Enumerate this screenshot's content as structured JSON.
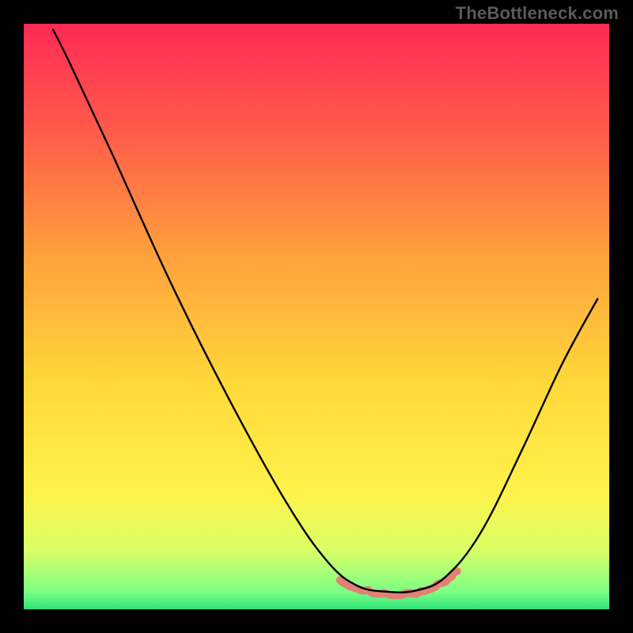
{
  "watermark": "TheBottleneck.com",
  "chart_data": {
    "type": "line",
    "title": "",
    "xlabel": "",
    "ylabel": "",
    "xlim": [
      0,
      100
    ],
    "ylim": [
      0,
      100
    ],
    "grid": false,
    "legend": false,
    "background_gradient": {
      "stops": [
        {
          "offset": 0.0,
          "color": "#ff2a55"
        },
        {
          "offset": 0.18,
          "color": "#ff5a4a"
        },
        {
          "offset": 0.4,
          "color": "#ffa23c"
        },
        {
          "offset": 0.62,
          "color": "#ffd93a"
        },
        {
          "offset": 0.8,
          "color": "#fff24a"
        },
        {
          "offset": 0.9,
          "color": "#d9ff66"
        },
        {
          "offset": 0.97,
          "color": "#7cff84"
        },
        {
          "offset": 1.0,
          "color": "#30e47a"
        }
      ]
    },
    "series": [
      {
        "name": "bottleneck-curve",
        "stroke": "#000000",
        "width": 2.4,
        "points": [
          {
            "x": 5.0,
            "y": 99.0
          },
          {
            "x": 8.0,
            "y": 93.0
          },
          {
            "x": 15.0,
            "y": 78.0
          },
          {
            "x": 25.0,
            "y": 56.0
          },
          {
            "x": 35.0,
            "y": 36.0
          },
          {
            "x": 45.0,
            "y": 18.0
          },
          {
            "x": 52.0,
            "y": 8.0
          },
          {
            "x": 57.0,
            "y": 4.0
          },
          {
            "x": 62.0,
            "y": 3.0
          },
          {
            "x": 67.0,
            "y": 3.2
          },
          {
            "x": 72.0,
            "y": 5.5
          },
          {
            "x": 78.0,
            "y": 13.0
          },
          {
            "x": 85.0,
            "y": 27.0
          },
          {
            "x": 92.0,
            "y": 42.0
          },
          {
            "x": 98.0,
            "y": 53.0
          }
        ]
      }
    ],
    "wiggle_band": {
      "name": "minimum-wiggle",
      "stroke": "#e77a74",
      "width": 10,
      "points": [
        {
          "x": 54.0,
          "y": 5.0
        },
        {
          "x": 57.0,
          "y": 3.5
        },
        {
          "x": 60.0,
          "y": 2.8
        },
        {
          "x": 63.0,
          "y": 2.6
        },
        {
          "x": 66.0,
          "y": 2.6
        },
        {
          "x": 69.0,
          "y": 3.2
        },
        {
          "x": 72.0,
          "y": 4.8
        },
        {
          "x": 74.0,
          "y": 6.5
        }
      ]
    }
  }
}
